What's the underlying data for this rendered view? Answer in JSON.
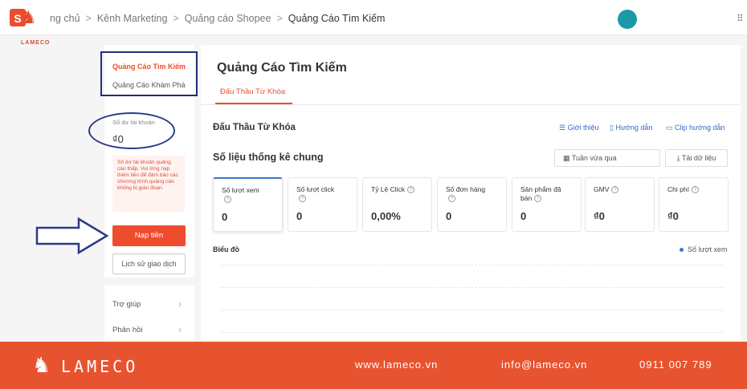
{
  "brand": {
    "shopee_glyph": "S",
    "logo_text": "LAMECO"
  },
  "breadcrumb": {
    "item1": "ng chủ",
    "item2": "Kênh Marketing",
    "item3": "Quảng cáo Shopee",
    "current": "Quảng Cáo Tìm Kiếm",
    "separator": ">"
  },
  "left_nav": {
    "item_active": "Quảng Cáo Tìm Kiếm",
    "item2": "Quảng Cáo Khám Phá"
  },
  "balance": {
    "label": "Số dư tài khoản",
    "value": "₫0",
    "warning": "Số dư tài khoản quảng cáo thấp. Vui lòng nạp thêm tiền để đảm bảo các chương trình quảng cáo không bị gián đoạn.",
    "topup_label": "Nạp tiền",
    "history_label": "Lịch sử giao dịch"
  },
  "help": {
    "item1": "Trợ giúp",
    "item2": "Phản hồi"
  },
  "main": {
    "title": "Quảng Cáo Tìm Kiếm",
    "tab": "Đấu Thầu Từ Khóa",
    "section_title": "Đấu Thầu Từ Khóa",
    "links": {
      "intro": "Giới thiệu",
      "guide": "Hướng dẫn",
      "clip": "Clip hướng dẫn"
    },
    "stats_title": "Số liệu thống kê chung",
    "date_range": "Tuần vừa qua",
    "download": "Tải dữ liệu",
    "chart_title": "Biểu đồ",
    "legend": "Số lượt xem"
  },
  "metrics": [
    {
      "label": "Số lượt xem",
      "value": "0"
    },
    {
      "label": "Số lượt click",
      "value": "0"
    },
    {
      "label": "Tỷ Lệ Click",
      "value": "0,00%"
    },
    {
      "label": "Số đơn hàng",
      "value": "0"
    },
    {
      "label": "Sản phẩm đã bán",
      "value": "0"
    },
    {
      "label": "GMV",
      "value": "₫0"
    },
    {
      "label": "Chi phí",
      "value": "₫0"
    }
  ],
  "footer": {
    "brand": "LAMECO",
    "website": "www.lameco.vn",
    "email": "info@lameco.vn",
    "phone": "0911 007 789"
  },
  "colors": {
    "accent": "#ee4d2d",
    "link": "#3566c8",
    "annotation": "#1f2f7a",
    "footer": "#e8532f"
  }
}
